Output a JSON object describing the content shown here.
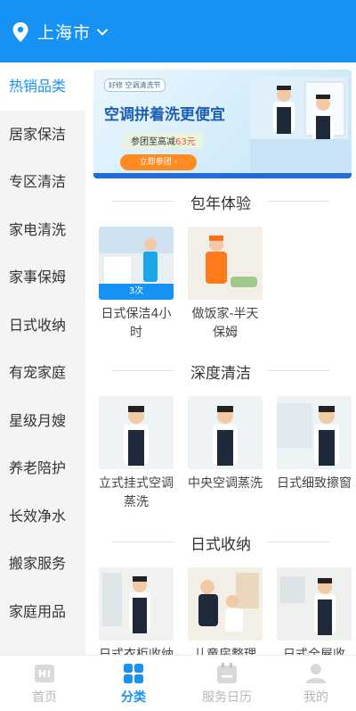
{
  "location": {
    "city": "上海市"
  },
  "sidebar": {
    "items": [
      {
        "label": "热销品类",
        "active": true
      },
      {
        "label": "居家保洁"
      },
      {
        "label": "专区清洁"
      },
      {
        "label": "家电清洗"
      },
      {
        "label": "家事保姆"
      },
      {
        "label": "日式收纳"
      },
      {
        "label": "有宠家庭"
      },
      {
        "label": "星级月嫂"
      },
      {
        "label": "养老陪护"
      },
      {
        "label": "长效净水"
      },
      {
        "label": "搬家服务"
      },
      {
        "label": "家庭用品"
      }
    ]
  },
  "banner": {
    "tag": "好修 空调清洗节",
    "headline": "空调拼着洗更便宜",
    "pill_prefix": "参团至高减",
    "pill_amount": "63元",
    "cta": "立即参团 ›"
  },
  "sections": [
    {
      "title": "包年体验",
      "cards": [
        {
          "caption": "日式保洁4小时",
          "badge": "3次"
        },
        {
          "caption": "做饭家-半天保姆"
        }
      ]
    },
    {
      "title": "深度清洁",
      "cards": [
        {
          "caption": "立式挂式空调蒸洗"
        },
        {
          "caption": "中央空调蒸洗"
        },
        {
          "caption": "日式细致擦窗"
        }
      ]
    },
    {
      "title": "日式收纳",
      "cards": [
        {
          "caption": "日式衣柜收纳"
        },
        {
          "caption": "儿童房整理"
        },
        {
          "caption": "日式全屋收"
        }
      ]
    }
  ],
  "tabbar": {
    "items": [
      {
        "label": "首页",
        "icon": "home-icon"
      },
      {
        "label": "分类",
        "icon": "category-icon",
        "active": true
      },
      {
        "label": "服务日历",
        "icon": "calendar-icon"
      },
      {
        "label": "我的",
        "icon": "user-icon"
      }
    ]
  },
  "colors": {
    "primary": "#1592f4",
    "accent": "#ff8a1f",
    "sidebar_bg": "#f3f4f6"
  }
}
